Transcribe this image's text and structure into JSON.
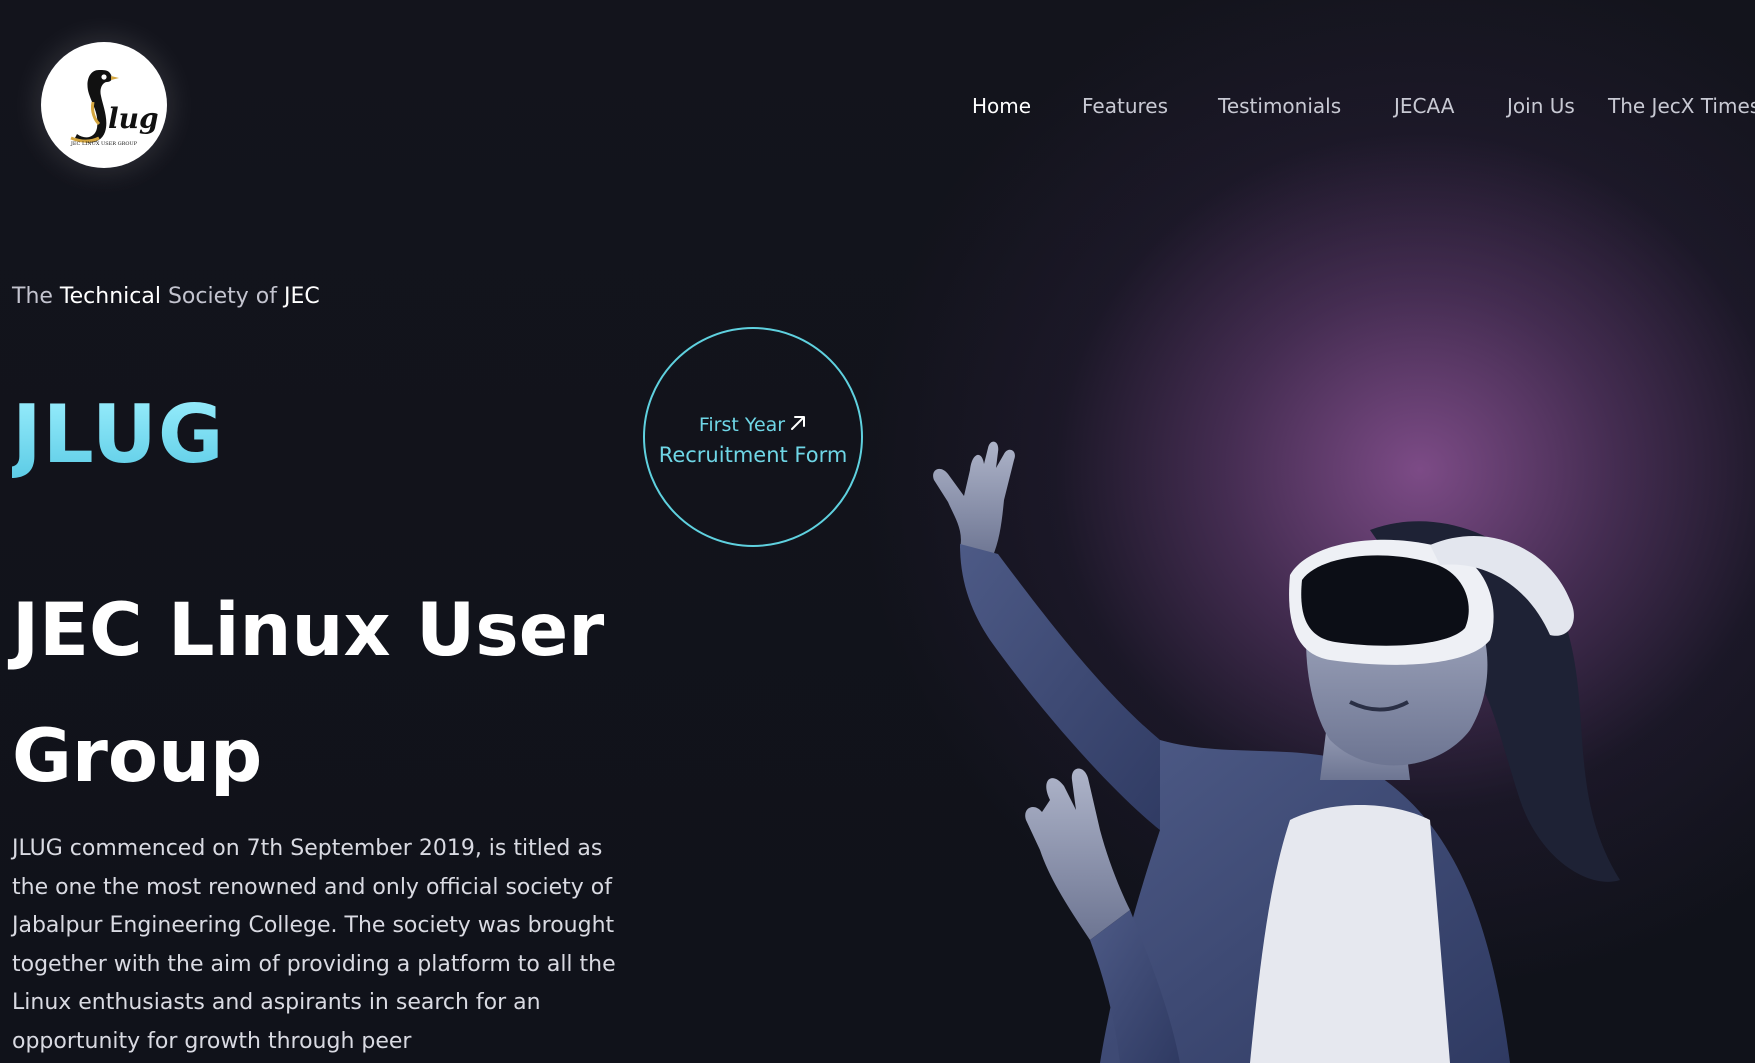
{
  "logo": {
    "alt": "JLUG",
    "wordmark": "lug",
    "subtitle": "JEC LINUX USER GROUP"
  },
  "nav": {
    "items": [
      {
        "label": "Home",
        "active": true
      },
      {
        "label": "Features",
        "active": false
      },
      {
        "label": "Testimonials",
        "active": false
      },
      {
        "label": "JECAA",
        "active": false
      },
      {
        "label": "Join Us",
        "active": false
      },
      {
        "label": "The JecX Times",
        "active": false
      }
    ]
  },
  "hero": {
    "tagline": {
      "w1": "The ",
      "w2": "Technical",
      "w3": " Society of ",
      "w4": "JEC"
    },
    "brand": "JLUG",
    "headline": "JEC Linux User Group",
    "description": "JLUG commenced on 7th September 2019, is titled as the one the most renowned and only official society of Jabalpur Engineering College. The society was brought together with the aim of providing a platform to all the Linux enthusiasts and aspirants in search for an opportunity for growth through peer"
  },
  "recruit_button": {
    "line1": "First Year",
    "line2": "Recruitment Form",
    "icon": "arrow-up-right-icon"
  },
  "image": {
    "subject": "vr-headset-person-image"
  },
  "colors": {
    "accent": "#5fd1df",
    "background": "#0f111a",
    "glow": "#824e8c"
  }
}
